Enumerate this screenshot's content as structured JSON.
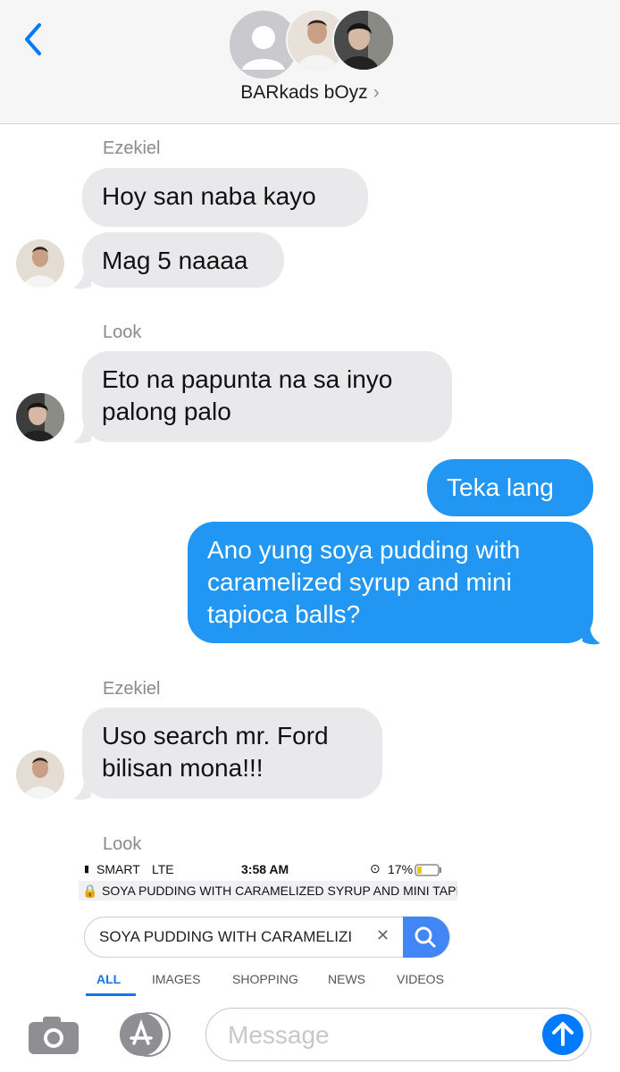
{
  "header": {
    "group_name": "BARkads bOyz",
    "chevron": "›",
    "icons": [
      "back-chevron-icon",
      "contact-placeholder-icon"
    ]
  },
  "messages": [
    {
      "type": "sender",
      "text": "Ezekiel"
    },
    {
      "type": "in",
      "text": "Hoy san naba kayo"
    },
    {
      "type": "in",
      "text": "Mag 5 naaaa"
    },
    {
      "type": "sender",
      "text": "Look"
    },
    {
      "type": "in",
      "text": [
        "Eto na papunta na sa inyo",
        "palong palo"
      ]
    },
    {
      "type": "out",
      "text": "Teka lang"
    },
    {
      "type": "out",
      "text": [
        "Ano yung soya pudding with",
        "caramelized syrup and mini",
        "tapioca balls?"
      ]
    },
    {
      "type": "sender",
      "text": "Ezekiel"
    },
    {
      "type": "in",
      "text": [
        "Uso search mr. Ford",
        "bilisan mona!!!"
      ]
    },
    {
      "type": "sender",
      "text": "Look"
    }
  ],
  "screenshot": {
    "carrier": "SMART",
    "network": "LTE",
    "time": "3:58 AM",
    "battery": "17%",
    "url": "SOYA PUDDING WITH CARAMELIZED SYRUP AND MINI TAPIOC",
    "query": "SOYA PUDDING WITH CARAMELIZI",
    "clear": "✕",
    "tabs": [
      "ALL",
      "IMAGES",
      "SHOPPING",
      "NEWS",
      "VIDEOS"
    ],
    "active_tab": "ALL"
  },
  "composer": {
    "placeholder": "Message"
  },
  "colors": {
    "outgoing": "#2196f3",
    "incoming": "#e9e9eb",
    "ios_blue": "#007aff",
    "search_blue": "#4285f4"
  }
}
